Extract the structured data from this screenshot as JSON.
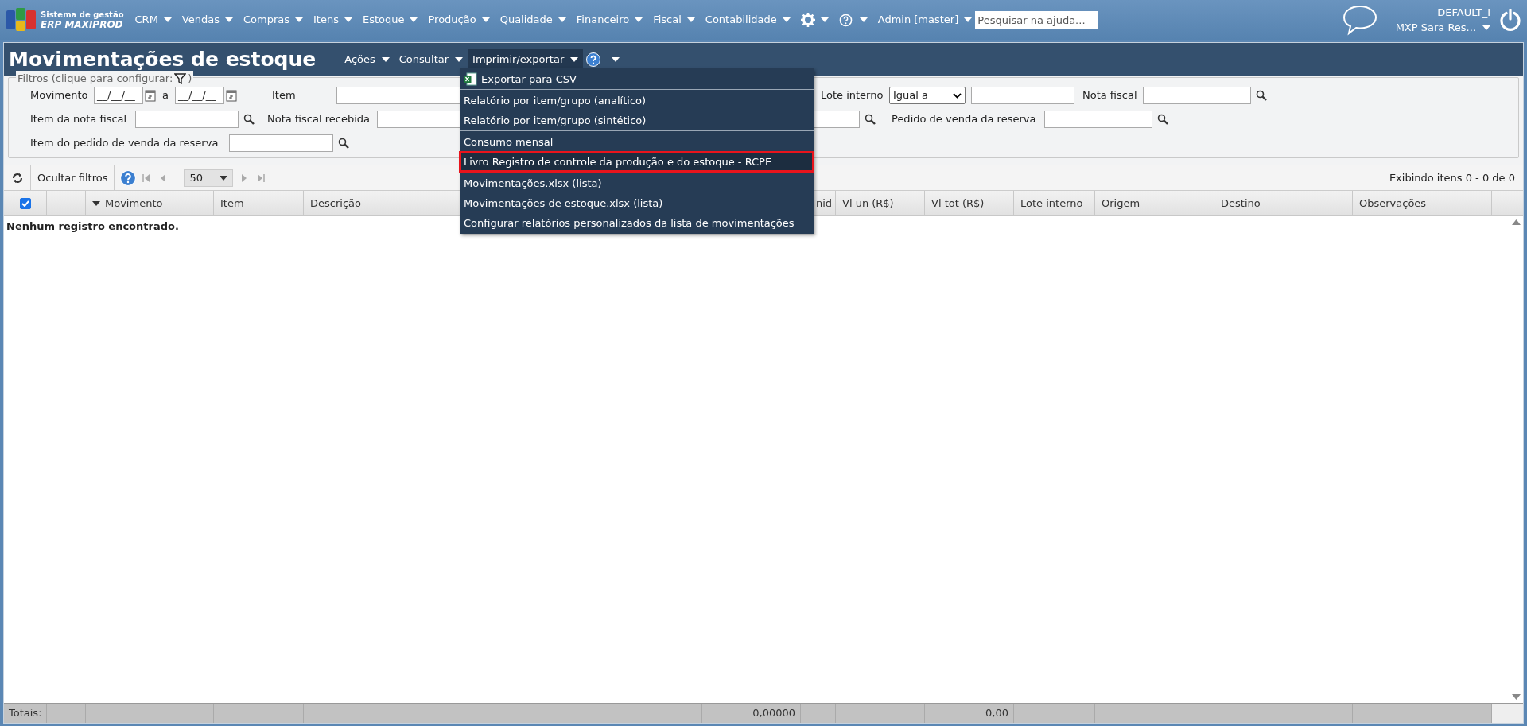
{
  "top_bar": {
    "logo": {
      "line1": "Sistema de gestão",
      "line2": "ERP MAXIPROD"
    },
    "menus": [
      {
        "label": "CRM"
      },
      {
        "label": "Vendas"
      },
      {
        "label": "Compras"
      },
      {
        "label": "Itens"
      },
      {
        "label": "Estoque"
      },
      {
        "label": "Produção"
      },
      {
        "label": "Qualidade"
      },
      {
        "label": "Financeiro"
      },
      {
        "label": "Fiscal"
      },
      {
        "label": "Contabilidade"
      }
    ],
    "user_menu": "Admin [master]",
    "help_search": {
      "placeholder": "Pesquisar na ajuda..."
    },
    "company": {
      "line1": "DEFAULT_I",
      "line2": "MXP Sara Res..."
    }
  },
  "page": {
    "title": "Movimentações de estoque",
    "actions": [
      {
        "label": "Ações",
        "selected": false
      },
      {
        "label": "Consultar",
        "selected": false
      },
      {
        "label": "Imprimir/exportar",
        "selected": true
      }
    ]
  },
  "export_menu": {
    "groups": [
      {
        "items": [
          {
            "kind": "file",
            "label": "Exportar para CSV",
            "highlighted": false
          }
        ]
      },
      {
        "items": [
          {
            "kind": "text",
            "label": "Relatório por item/grupo (analítico)",
            "highlighted": false
          },
          {
            "kind": "text",
            "label": "Relatório por item/grupo (sintético)",
            "highlighted": false
          }
        ]
      },
      {
        "items": [
          {
            "kind": "text",
            "label": "Consumo mensal",
            "highlighted": false
          },
          {
            "kind": "text",
            "label": "Livro Registro de controle da produção e do estoque - RCPE",
            "highlighted": true
          }
        ]
      },
      {
        "items": [
          {
            "kind": "text",
            "label": "Movimentações.xlsx (lista)",
            "highlighted": false
          },
          {
            "kind": "text",
            "label": "Movimentações de estoque.xlsx (lista)",
            "highlighted": false
          },
          {
            "kind": "text",
            "label": "Configurar relatórios personalizados da lista de movimentações",
            "highlighted": false
          }
        ]
      }
    ]
  },
  "filters": {
    "legend": "Filtros (clique para configurar:",
    "legend_end": ")",
    "rows": [
      [
        {
          "kind": "date_range",
          "label": "Movimento",
          "from": "__/__/__",
          "separator": "a",
          "to": "__/__/__"
        },
        {
          "kind": "text",
          "label": "Item"
        },
        {
          "kind": "select_text",
          "label": "Lote interno",
          "option": "Igual a"
        },
        {
          "kind": "search",
          "label": "Nota fiscal"
        }
      ],
      [
        {
          "kind": "search",
          "label": "Item da nota fiscal"
        },
        {
          "kind": "search",
          "label": "Nota fiscal recebida"
        },
        {
          "kind": "search",
          "label": "Pedido de venda da reserva"
        }
      ],
      [
        {
          "kind": "search",
          "label": "Item do pedido de venda da reserva"
        }
      ]
    ]
  },
  "toolbar": {
    "hide_filters": "Ocultar filtros",
    "page_size": "50",
    "status": "Exibindo itens 0 - 0 de 0"
  },
  "table": {
    "columns": [
      {
        "kind": "checkbox",
        "checked": true,
        "total": "Totais:"
      },
      {
        "kind": "blank"
      },
      {
        "kind": "text",
        "label": "Movimento",
        "sorted": true
      },
      {
        "kind": "text",
        "label": "Item",
        "sorted": false
      },
      {
        "kind": "text",
        "label": "Descrição",
        "sorted": false
      },
      {
        "kind": "covered"
      },
      {
        "kind": "covered",
        "total": "0,00000"
      },
      {
        "kind": "text",
        "label": "nid",
        "sorted": false
      },
      {
        "kind": "text",
        "label": "Vl un (R$)",
        "sorted": false
      },
      {
        "kind": "text",
        "label": "Vl tot (R$)",
        "sorted": false,
        "total": "0,00"
      },
      {
        "kind": "text",
        "label": "Lote interno",
        "sorted": false
      },
      {
        "kind": "text",
        "label": "Origem",
        "sorted": false
      },
      {
        "kind": "text",
        "label": "Destino",
        "sorted": false
      },
      {
        "kind": "text",
        "label": "Observações",
        "sorted": false
      }
    ],
    "empty_message": "Nenhum registro encontrado."
  }
}
